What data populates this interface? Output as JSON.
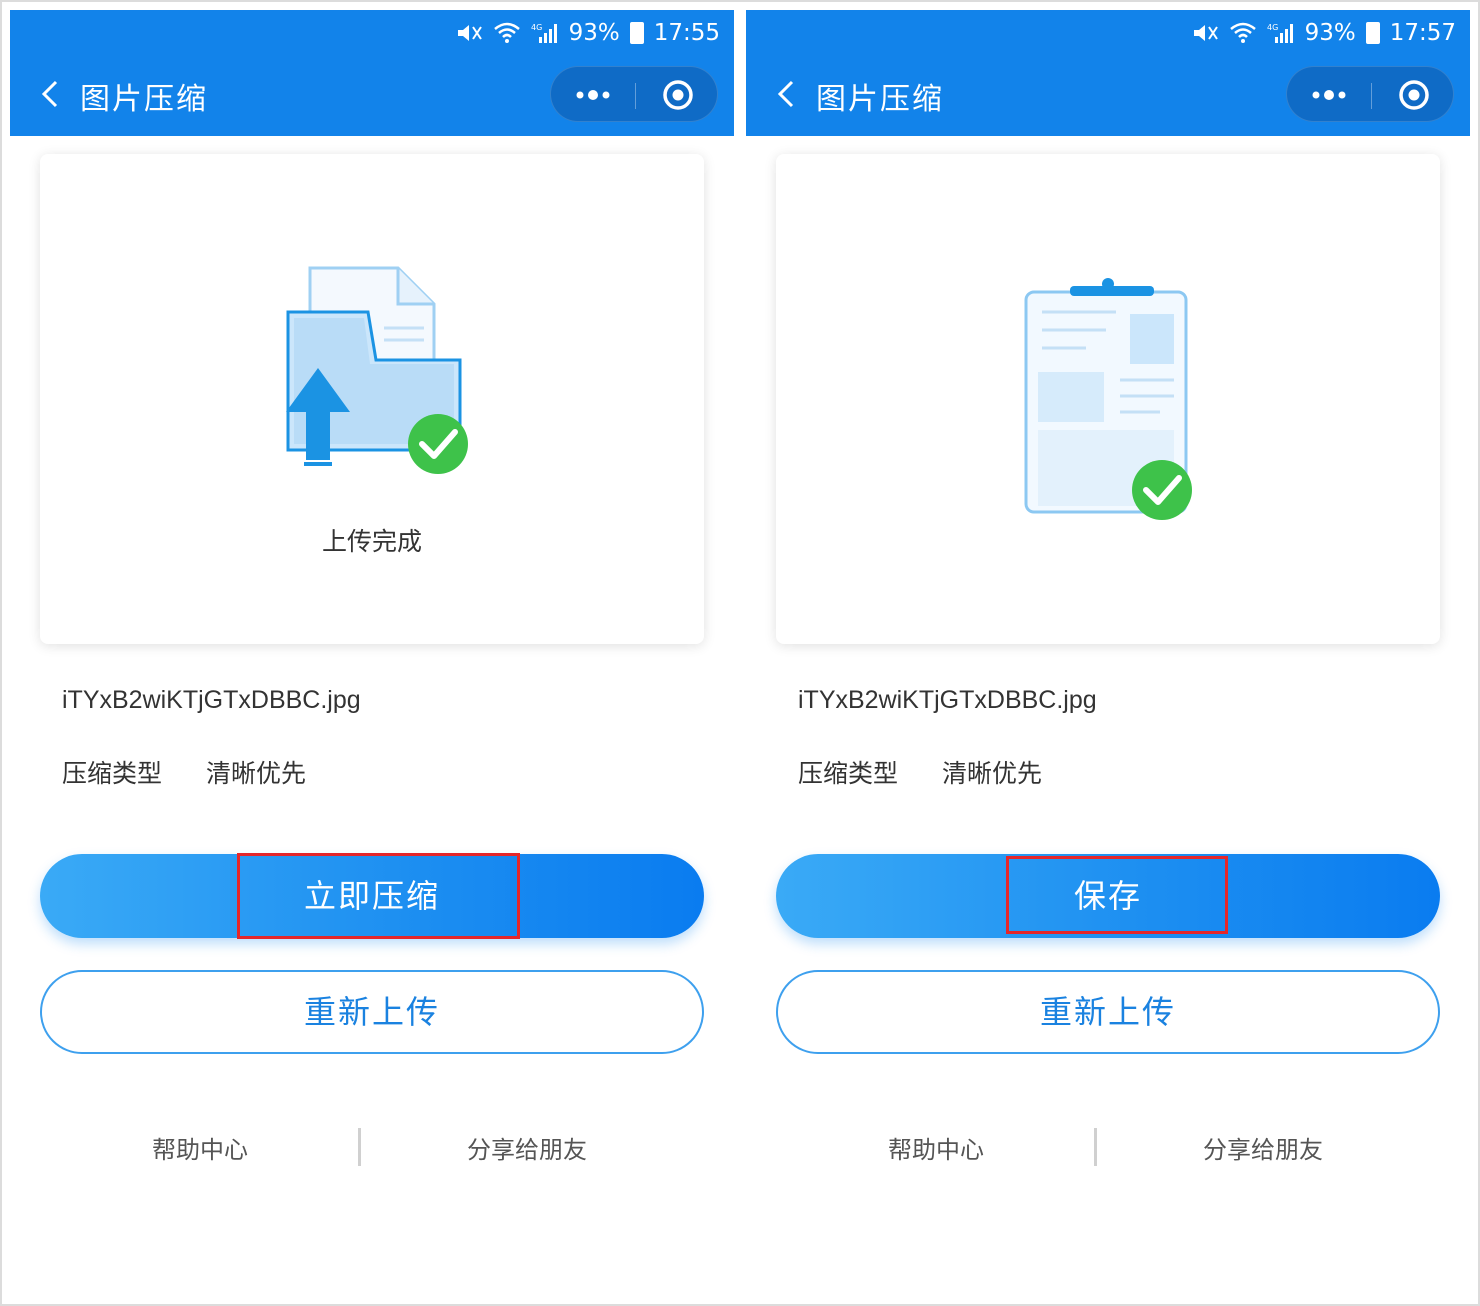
{
  "screens": [
    {
      "status_bar": {
        "battery": "93%",
        "time": "17:55"
      },
      "nav": {
        "title": "图片压缩"
      },
      "card": {
        "status_text": "上传完成"
      },
      "file_name": "iTYxB2wiKTjGTxDBBC.jpg",
      "compress_type": {
        "label": "压缩类型",
        "value": "清晰优先"
      },
      "primary_button": "立即压缩",
      "secondary_button": "重新上传",
      "footer": {
        "help": "帮助中心",
        "share": "分享给朋友"
      }
    },
    {
      "status_bar": {
        "battery": "93%",
        "time": "17:57"
      },
      "nav": {
        "title": "图片压缩"
      },
      "file_name": "iTYxB2wiKTjGTxDBBC.jpg",
      "compress_type": {
        "label": "压缩类型",
        "value": "清晰优先"
      },
      "primary_button": "保存",
      "secondary_button": "重新上传",
      "footer": {
        "help": "帮助中心",
        "share": "分享给朋友"
      }
    }
  ],
  "colors": {
    "header_blue": "#1283ea",
    "accent": "#1a82e0",
    "success_green": "#3ec24a",
    "highlight_red": "#e5262a"
  }
}
